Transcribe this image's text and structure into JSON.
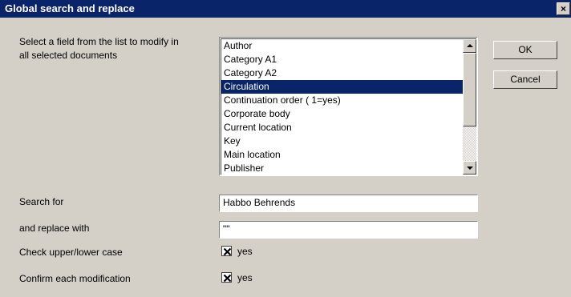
{
  "window": {
    "title": "Global search and replace",
    "close_label": "×"
  },
  "field_prompt": {
    "line1": "Select a field from the list to modify in",
    "line2": "all selected documents"
  },
  "field_list": {
    "items": [
      {
        "label": "Author",
        "selected": false
      },
      {
        "label": "Category A1",
        "selected": false
      },
      {
        "label": "Category A2",
        "selected": false
      },
      {
        "label": "Circulation",
        "selected": true
      },
      {
        "label": "Continuation order ( 1=yes)",
        "selected": false
      },
      {
        "label": "Corporate body",
        "selected": false
      },
      {
        "label": "Current location",
        "selected": false
      },
      {
        "label": "Key",
        "selected": false
      },
      {
        "label": "Main location",
        "selected": false
      },
      {
        "label": "Publisher",
        "selected": false
      }
    ]
  },
  "buttons": {
    "ok_label": "OK",
    "cancel_label": "Cancel"
  },
  "search": {
    "label": "Search for",
    "value": "Habbo Behrends"
  },
  "replace": {
    "label": "and replace with",
    "value": "\"\""
  },
  "options": {
    "case_label": "Check upper/lower case",
    "case_checked": true,
    "case_text": "yes",
    "confirm_label": "Confirm each modification",
    "confirm_checked": true,
    "confirm_text": "yes"
  },
  "colors": {
    "title_bar": "#0a246a",
    "selection": "#0a246a",
    "face": "#d4d0c8"
  }
}
